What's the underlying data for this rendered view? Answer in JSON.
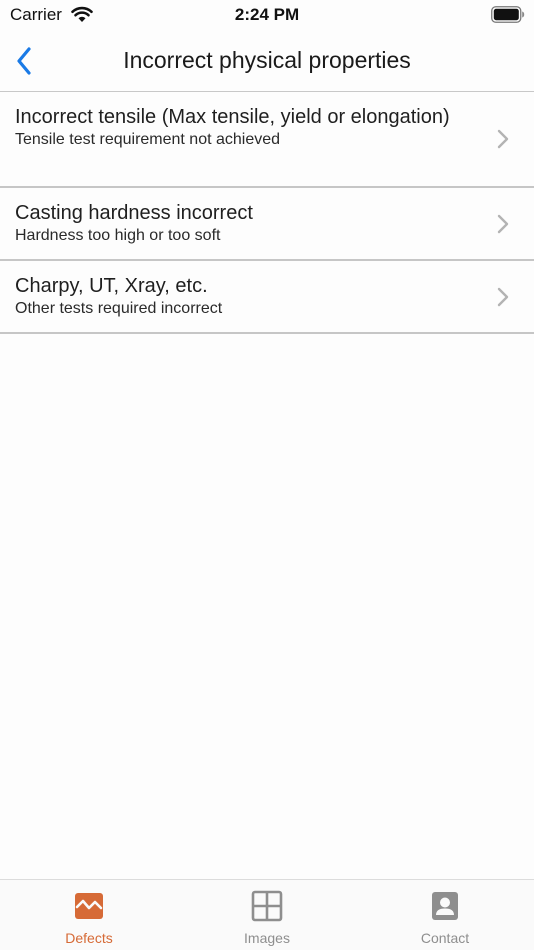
{
  "status_bar": {
    "carrier": "Carrier",
    "time": "2:24 PM"
  },
  "nav": {
    "title": "Incorrect physical properties",
    "accent_color": "#1a7ae6"
  },
  "items": [
    {
      "title": "Incorrect tensile (Max tensile, yield or elongation)",
      "subtitle": "Tensile test requirement not achieved"
    },
    {
      "title": "Casting hardness incorrect",
      "subtitle": "Hardness too high or too soft"
    },
    {
      "title": "Charpy, UT, Xray, etc.",
      "subtitle": "Other tests required incorrect"
    }
  ],
  "tabs": [
    {
      "label": "Defects",
      "icon": "defects-icon",
      "active": true
    },
    {
      "label": "Images",
      "icon": "grid-icon",
      "active": false
    },
    {
      "label": "Contact",
      "icon": "contact-icon",
      "active": false
    }
  ],
  "colors": {
    "tab_active": "#d66a36",
    "tab_inactive": "#8e8e8e"
  }
}
